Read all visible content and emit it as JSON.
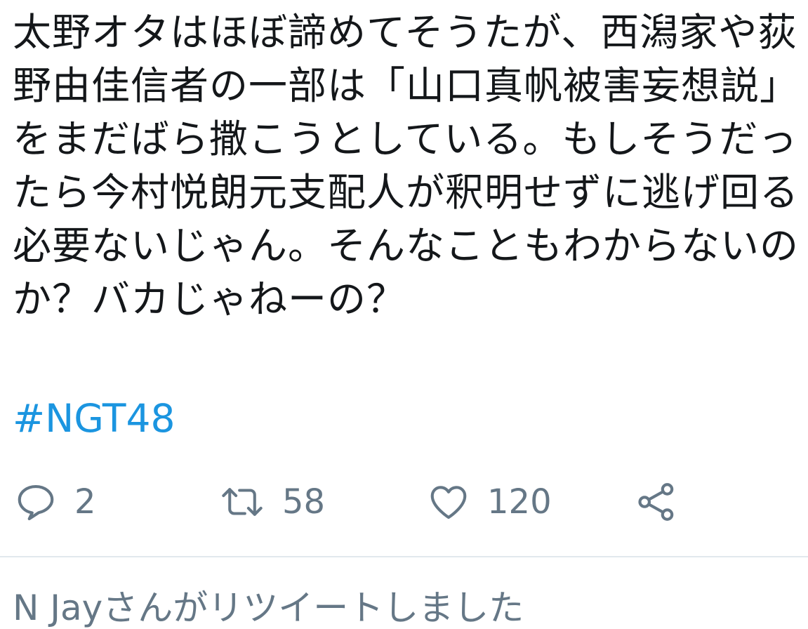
{
  "tweet": {
    "text": "太野オタはほぼ諦めてそうたが、西潟家や荻野由佳信者の一部は「山口真帆被害妄想説」をまだばら撒こうとしている。もしそうだったら今村悦朗元支配人が釈明せずに逃げ回る必要ないじゃん。そんなこともわからないのか？バカじゃねーの？",
    "hashtag": "#NGT48"
  },
  "actions": {
    "reply": {
      "icon": "reply-icon",
      "count": "2"
    },
    "retweet": {
      "icon": "retweet-icon",
      "count": "58"
    },
    "like": {
      "icon": "heart-icon",
      "count": "120"
    },
    "share": {
      "icon": "share-icon"
    }
  },
  "social_context": {
    "text": "N Jayさんがリツイートしました"
  },
  "colors": {
    "text": "#14171a",
    "hashtag": "#1b95e0",
    "icon": "#657786",
    "divider": "#e1e8ed"
  }
}
